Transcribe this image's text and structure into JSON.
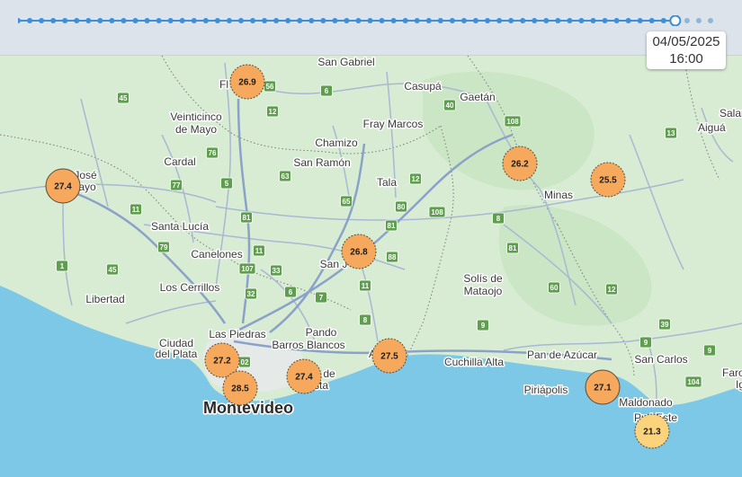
{
  "time": {
    "date": "04/05/2025",
    "hour": "16:00",
    "total_steps": 60,
    "current_step": 56
  },
  "colors": {
    "land": "#d8ecd4",
    "water": "#7cc8e6",
    "road": "#ffffff",
    "highway": "#9fb4d2",
    "shield": "#5f9e4e",
    "marker_warm": "#f6a95d",
    "marker_mild": "#fbd37d",
    "timeline": "#3c8fd8"
  },
  "places": [
    {
      "id": "san-gabriel",
      "name": "San Gabriel"
    },
    {
      "id": "casupa",
      "name": "Casupá"
    },
    {
      "id": "gaetan",
      "name": "Gaetán"
    },
    {
      "id": "florida",
      "name": "Fl"
    },
    {
      "id": "veinticinco-de-mayo",
      "name": "Veinticinco de Mayo"
    },
    {
      "id": "fray-marcos",
      "name": "Fray Marcos"
    },
    {
      "id": "chamizo",
      "name": "Chamizo"
    },
    {
      "id": "cardal",
      "name": "Cardal"
    },
    {
      "id": "san-ramon",
      "name": "San Ramón"
    },
    {
      "id": "tala",
      "name": "Tala"
    },
    {
      "id": "minas",
      "name": "Minas"
    },
    {
      "id": "jose",
      "name": "José"
    },
    {
      "id": "mayo",
      "name": "ayo"
    },
    {
      "id": "santa-lucia",
      "name": "Santa Lucía"
    },
    {
      "id": "canelones",
      "name": "Canelones"
    },
    {
      "id": "san-jacinto",
      "name": "San J"
    },
    {
      "id": "solis-de-mataojo",
      "name": "Solís de Mataojo"
    },
    {
      "id": "libertad",
      "name": "Libertad"
    },
    {
      "id": "los-cerrillos",
      "name": "Los Cerrillos"
    },
    {
      "id": "las-piedras",
      "name": "Las Piedras"
    },
    {
      "id": "pando",
      "name": "Pando"
    },
    {
      "id": "barros-blancos",
      "name": "Barros Blancos"
    },
    {
      "id": "ciudad-del-plata",
      "name": "Ciudad del Plata"
    },
    {
      "id": "atlantida",
      "name": "A"
    },
    {
      "id": "cuchilla-alta",
      "name": "Cuchilla Alta"
    },
    {
      "id": "pan-de-azucar",
      "name": "Pan de Azúcar"
    },
    {
      "id": "san-carlos",
      "name": "San Carlos"
    },
    {
      "id": "piriapolis",
      "name": "Piriápolis"
    },
    {
      "id": "maldonado",
      "name": "Maldonado"
    },
    {
      "id": "punta-del-este",
      "name": "Pu    l Este"
    },
    {
      "id": "montevideo",
      "name": "Montevideo"
    },
    {
      "id": "salto",
      "name": "Salar"
    },
    {
      "id": "aigua",
      "name": "Aiguá"
    },
    {
      "id": "faro",
      "name": "Faro"
    },
    {
      "id": "de",
      "name": "de"
    },
    {
      "id": "sta",
      "name": "sta"
    },
    {
      "id": "ig",
      "name": "Ig"
    }
  ],
  "routes": [
    "56",
    "12",
    "6",
    "40",
    "108",
    "13",
    "45",
    "76",
    "63",
    "5",
    "77",
    "11",
    "81",
    "79",
    "65",
    "12",
    "80",
    "108",
    "8",
    "107",
    "11",
    "33",
    "81",
    "88",
    "1",
    "45",
    "32",
    "6",
    "7",
    "11",
    "8",
    "60",
    "12",
    "9",
    "39",
    "9",
    "9",
    "104",
    "02",
    "81"
  ],
  "markers": [
    {
      "id": "m1",
      "value": "26.9",
      "tone": "warm"
    },
    {
      "id": "m2",
      "value": "27.4",
      "tone": "warm"
    },
    {
      "id": "m3",
      "value": "26.2",
      "tone": "warm"
    },
    {
      "id": "m4",
      "value": "25.5",
      "tone": "warm"
    },
    {
      "id": "m5",
      "value": "26.8",
      "tone": "warm"
    },
    {
      "id": "m6",
      "value": "27.2",
      "tone": "warm"
    },
    {
      "id": "m7",
      "value": "28.5",
      "tone": "warm"
    },
    {
      "id": "m8",
      "value": "27.4",
      "tone": "warm"
    },
    {
      "id": "m9",
      "value": "27.5",
      "tone": "warm"
    },
    {
      "id": "m10",
      "value": "27.1",
      "tone": "warm"
    },
    {
      "id": "m11",
      "value": "21.3",
      "tone": "mild"
    }
  ]
}
